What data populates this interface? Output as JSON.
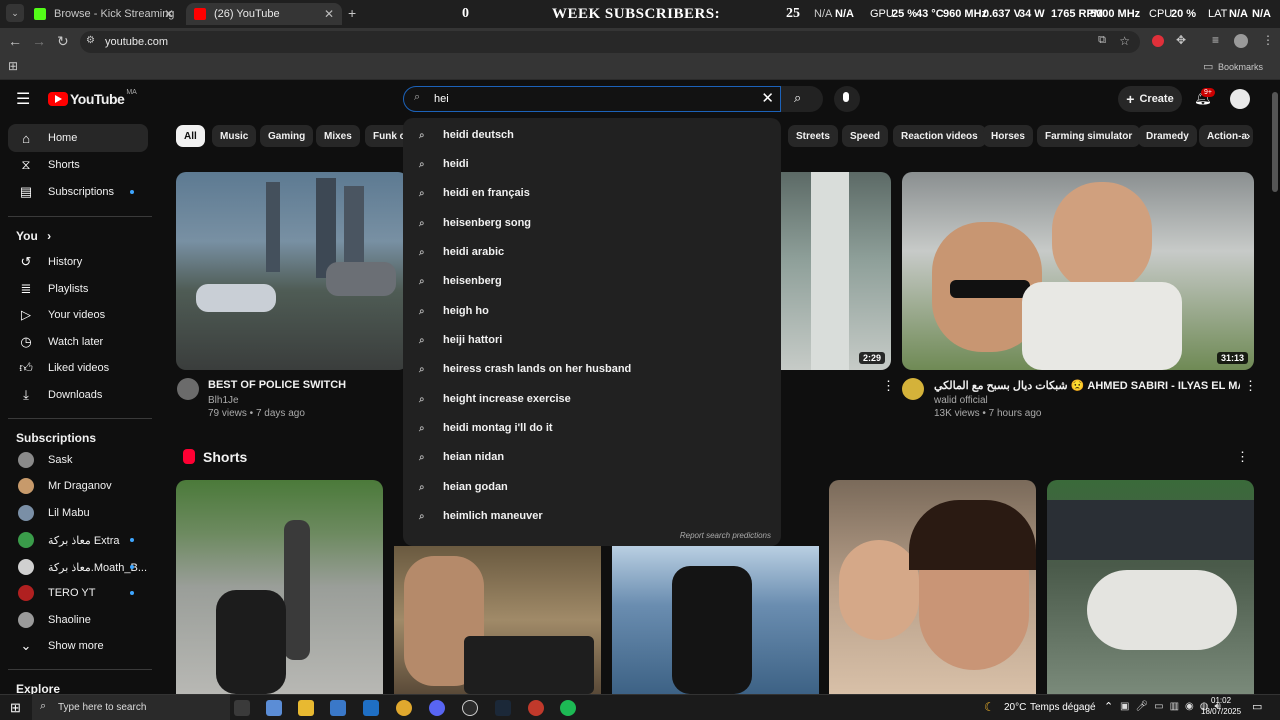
{
  "browser": {
    "tabs": [
      {
        "title": "Browse - Kick Streaming",
        "color": "#53fc18"
      },
      {
        "title": "(26) YouTube",
        "color": "#ff0000"
      }
    ],
    "new_tab": "+",
    "url": "youtube.com",
    "bookmarks_label": "Bookmarks"
  },
  "overlay": {
    "left_count": "0",
    "banner": "WEEK SUBSCRIBERS:",
    "right_count": "25",
    "na1": "N/A",
    "na2": "N/A",
    "gpu": "GPU",
    "gpu_pct": "25 %",
    "gpu_temp": "43 °C",
    "gpu_clock": "960 MHz",
    "gpu_v": "0.637 V",
    "gpu_w": "34 W",
    "gpu_rpm": "1765 RPM",
    "gpu_mem": "5000 MHz",
    "cpu": "CPU",
    "cpu_pct": "20 %",
    "lat": "LAT",
    "na3": "N/A",
    "na4": "N/A"
  },
  "youtube": {
    "logo": "YouTube",
    "region": "MA",
    "search_value": "hei",
    "create_label": "Create",
    "notif_count": "9+"
  },
  "sidebar": {
    "main": [
      {
        "label": "Home",
        "icon": "home-icon"
      },
      {
        "label": "Shorts",
        "icon": "shorts-icon"
      },
      {
        "label": "Subscriptions",
        "icon": "subscriptions-icon"
      }
    ],
    "you_header": "You",
    "you": [
      {
        "label": "History",
        "icon": "history-icon"
      },
      {
        "label": "Playlists",
        "icon": "playlists-icon"
      },
      {
        "label": "Your videos",
        "icon": "your-videos-icon"
      },
      {
        "label": "Watch later",
        "icon": "watch-later-icon"
      },
      {
        "label": "Liked videos",
        "icon": "liked-icon"
      },
      {
        "label": "Downloads",
        "icon": "download-icon"
      }
    ],
    "subs_header": "Subscriptions",
    "subs": [
      {
        "label": "Sask",
        "color": "#8a8a8a"
      },
      {
        "label": "Mr Draganov",
        "color": "#c79a6b"
      },
      {
        "label": "Lil Mabu",
        "color": "#7a8fa6"
      },
      {
        "label": "معاذ بركة Extra",
        "color": "#3a9c4a"
      },
      {
        "label": "معاذ بركة.Moath_B...",
        "color": "#d0d0d0"
      },
      {
        "label": "TERO YT",
        "color": "#b02020"
      },
      {
        "label": "Shaoline",
        "color": "#9a9a9a"
      }
    ],
    "show_more": "Show more",
    "explore_header": "Explore"
  },
  "chips": [
    "All",
    "Music",
    "Gaming",
    "Mixes",
    "Funk c",
    "Streets",
    "Speed",
    "Reaction videos",
    "Horses",
    "Farming simulator",
    "Dramedy",
    "Action-a"
  ],
  "videos": [
    {
      "title": "BEST OF POLICE SWITCH",
      "channel": "Blh1Je",
      "meta": "79 views • 7 days ago"
    },
    {
      "duration": "2:29"
    },
    {
      "title": "شبكات ديال بسبح مع المالكي 😟 AHMED SABIRI - ILYAS EL MALKI",
      "channel": "walid official",
      "meta": "13K views • 7 hours ago",
      "duration": "31:13"
    }
  ],
  "shorts_header": "Shorts",
  "suggestions": [
    "heidi deutsch",
    "heidi",
    "heidi en français",
    "heisenberg song",
    "heidi arabic",
    "heisenberg",
    "heigh ho",
    "heiji hattori",
    "heiress crash lands on her husband",
    "height increase exercise",
    "heidi montag i'll do it",
    "heian nidan",
    "heian godan",
    "heimlich maneuver"
  ],
  "report_label": "Report search predictions",
  "taskbar": {
    "search_placeholder": "Type here to search",
    "weather": "20°C",
    "weather_text": "Temps dégagé",
    "time": "01:02",
    "date": "18/07/2025"
  },
  "colors": {
    "yt_red": "#ff0000",
    "bg": "#0f0f0f",
    "link_blue": "#3ea6ff"
  }
}
